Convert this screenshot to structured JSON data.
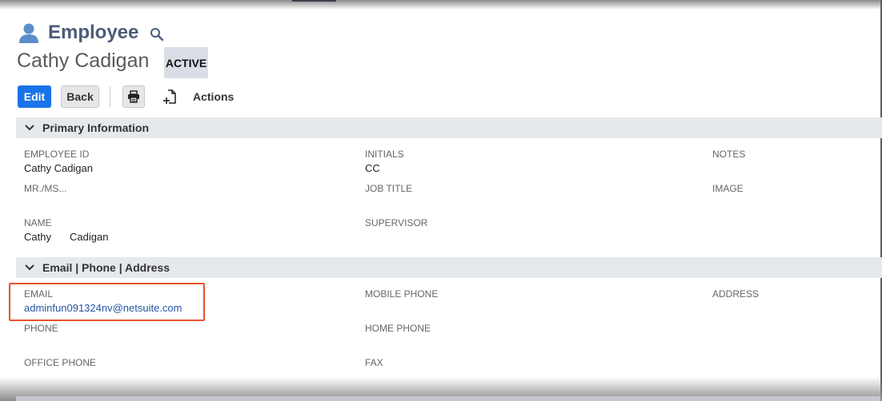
{
  "header": {
    "record_type": "Employee",
    "record_name": "Cathy Cadigan",
    "status": "ACTIVE"
  },
  "toolbar": {
    "edit_label": "Edit",
    "back_label": "Back",
    "actions_label": "Actions"
  },
  "sections": {
    "primary": {
      "title": "Primary Information",
      "fields": {
        "employee_id": {
          "label": "EMPLOYEE ID",
          "value": "Cathy Cadigan"
        },
        "initials": {
          "label": "INITIALS",
          "value": "CC"
        },
        "notes": {
          "label": "NOTES",
          "value": ""
        },
        "salutation": {
          "label": "MR./MS...",
          "value": ""
        },
        "job_title": {
          "label": "JOB TITLE",
          "value": ""
        },
        "image": {
          "label": "IMAGE",
          "value": ""
        },
        "name": {
          "label": "NAME",
          "first": "Cathy",
          "last": "Cadigan"
        },
        "supervisor": {
          "label": "SUPERVISOR",
          "value": ""
        }
      }
    },
    "contact": {
      "title": "Email | Phone | Address",
      "fields": {
        "email": {
          "label": "EMAIL",
          "value": "adminfun091324nv@netsuite.com"
        },
        "mobile_phone": {
          "label": "MOBILE PHONE",
          "value": ""
        },
        "address": {
          "label": "ADDRESS",
          "value": ""
        },
        "phone": {
          "label": "PHONE",
          "value": ""
        },
        "home_phone": {
          "label": "HOME PHONE",
          "value": ""
        },
        "office_phone": {
          "label": "OFFICE PHONE",
          "value": ""
        },
        "fax": {
          "label": "FAX",
          "value": ""
        }
      }
    }
  },
  "icons": [
    "person-icon",
    "search-icon",
    "print-icon",
    "actions-icon",
    "chevron-down-icon"
  ],
  "colors": {
    "primary_button": "#1a73e8",
    "title_text": "#4b5d78",
    "section_bar": "#e5e8ec",
    "link": "#2556a3",
    "highlight": "#e8532b"
  }
}
